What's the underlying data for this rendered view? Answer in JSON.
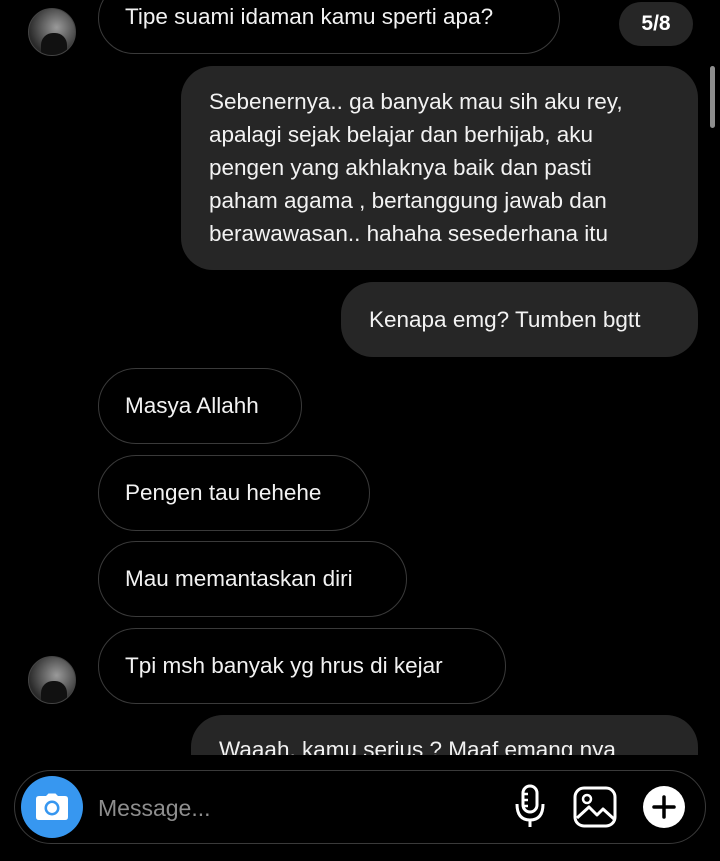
{
  "thread": {
    "counter": "5/8",
    "messages": [
      {
        "from": "them",
        "text": "Tipe suami idaman kamu sperti apa?"
      },
      {
        "from": "me",
        "lines": [
          "Sebenernya.. ga banyak mau sih aku rey,",
          "apalagi sejak belajar dan berhijab, aku",
          "pengen yang akhlaknya baik dan pasti",
          "paham agama , bertanggung jawab dan",
          "berawawasan.. hahaha sesederhana itu"
        ]
      },
      {
        "from": "me",
        "text": "Kenapa emg? Tumben bgtt"
      },
      {
        "from": "them",
        "text": "Masya Allahh"
      },
      {
        "from": "them",
        "text": "Pengen tau hehehe"
      },
      {
        "from": "them",
        "text": "Mau memantaskan diri"
      },
      {
        "from": "them",
        "text": "Tpi msh banyak yg hrus di kejar"
      },
      {
        "from": "me",
        "text": "Waaah, kamu serius ? Maaf emang nya"
      }
    ]
  },
  "composer": {
    "placeholder": "Message...",
    "icons": [
      "camera-icon",
      "microphone-icon",
      "gallery-icon",
      "plus-icon"
    ],
    "accent_color": "#3797f0"
  }
}
